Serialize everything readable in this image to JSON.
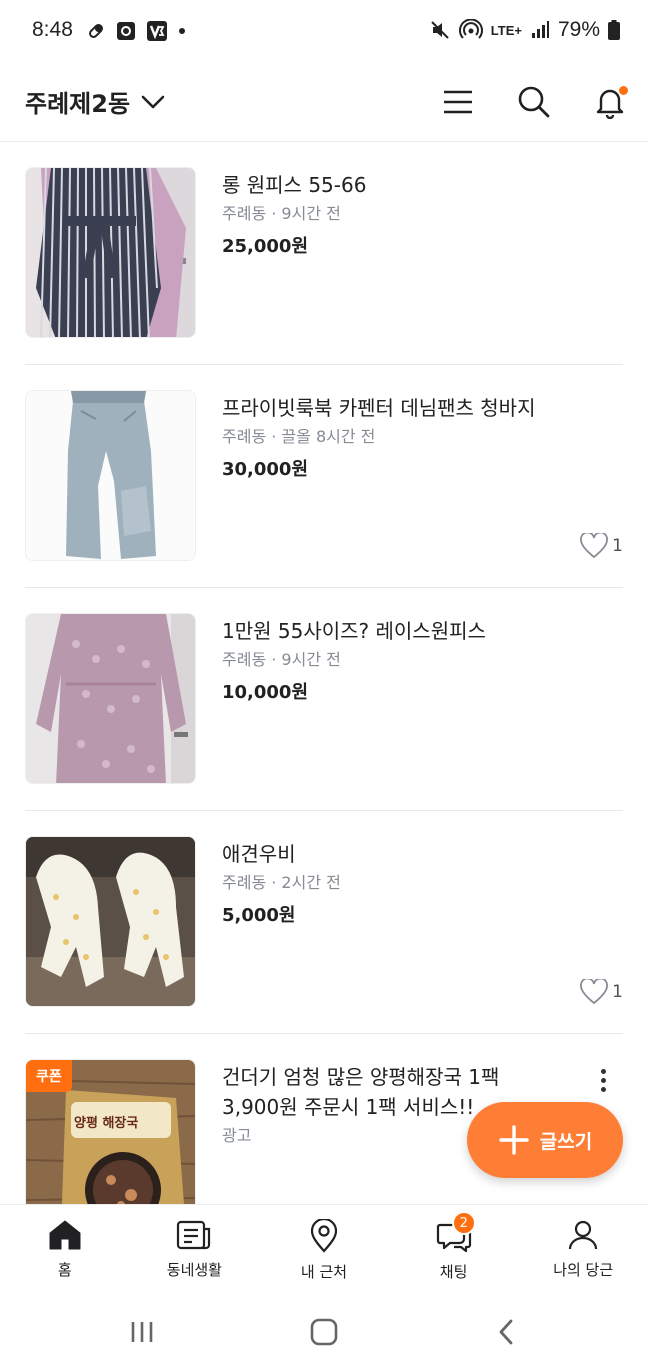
{
  "status_bar": {
    "time": "8:48",
    "network": "LTE+",
    "battery": "79%"
  },
  "header": {
    "location": "주례제2동"
  },
  "items": [
    {
      "title": "롱 원피스 55-66",
      "meta": "주례동 · 9시간 전",
      "price": "25,000원",
      "likes": ""
    },
    {
      "title": "프라이빗룩북 카펜터 데님팬츠 청바지",
      "meta": "주례동 · 끌올 8시간 전",
      "price": "30,000원",
      "likes": "1"
    },
    {
      "title": "1만원 55사이즈? 레이스원피스",
      "meta": "주례동 · 9시간 전",
      "price": "10,000원",
      "likes": ""
    },
    {
      "title": "애견우비",
      "meta": "주례동 · 2시간 전",
      "price": "5,000원",
      "likes": "1"
    }
  ],
  "ad": {
    "badge": "쿠폰",
    "title_line1": "건더기 엄청 많은 양평해장국 1팩",
    "title_line2": "3,900원 주문시 1팩 서비스!!",
    "label": "광고",
    "package_text": "양평 해장국"
  },
  "fab": {
    "label": "글쓰기"
  },
  "bottom_nav": {
    "home": "홈",
    "community": "동네생활",
    "nearby": "내 근처",
    "chat": "채팅",
    "chat_badge": "2",
    "my": "나의 당근"
  },
  "colors": {
    "accent": "#ff6f0f",
    "fab": "#ff7e36",
    "text": "#212124",
    "meta": "#868b94"
  }
}
